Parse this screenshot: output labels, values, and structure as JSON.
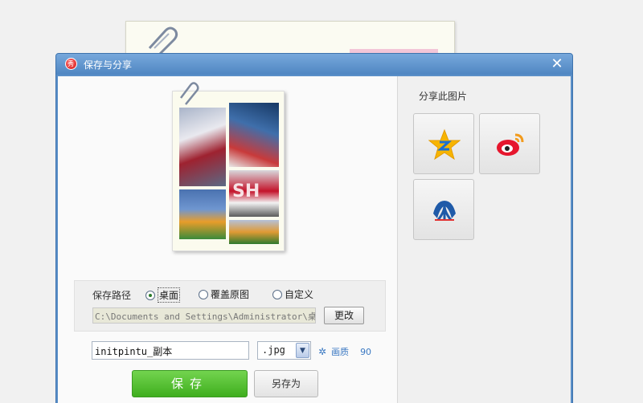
{
  "dialog": {
    "title": "保存与分享",
    "app_icon_text": "秀",
    "close_label": "✕"
  },
  "preview": {
    "overlay_text": "SH"
  },
  "save_path": {
    "label": "保存路径",
    "options": [
      {
        "label": "桌面",
        "selected": true
      },
      {
        "label": "覆盖原图",
        "selected": false
      },
      {
        "label": "自定义",
        "selected": false
      }
    ],
    "path_value": "C:\\Documents and Settings\\Administrator\\桌",
    "change_button": "更改"
  },
  "file": {
    "name": "initpintu_副本",
    "extension": ".jpg",
    "quality_label": "画质",
    "quality_value": "90"
  },
  "actions": {
    "save": "保存",
    "save_as": "另存为"
  },
  "share": {
    "title": "分享此图片",
    "targets": [
      {
        "icon": "qzone-icon",
        "color": "#f5b400"
      },
      {
        "icon": "weibo-icon",
        "color": "#e6162d"
      },
      {
        "icon": "renren-icon",
        "color": "#1f5aa8"
      }
    ]
  }
}
